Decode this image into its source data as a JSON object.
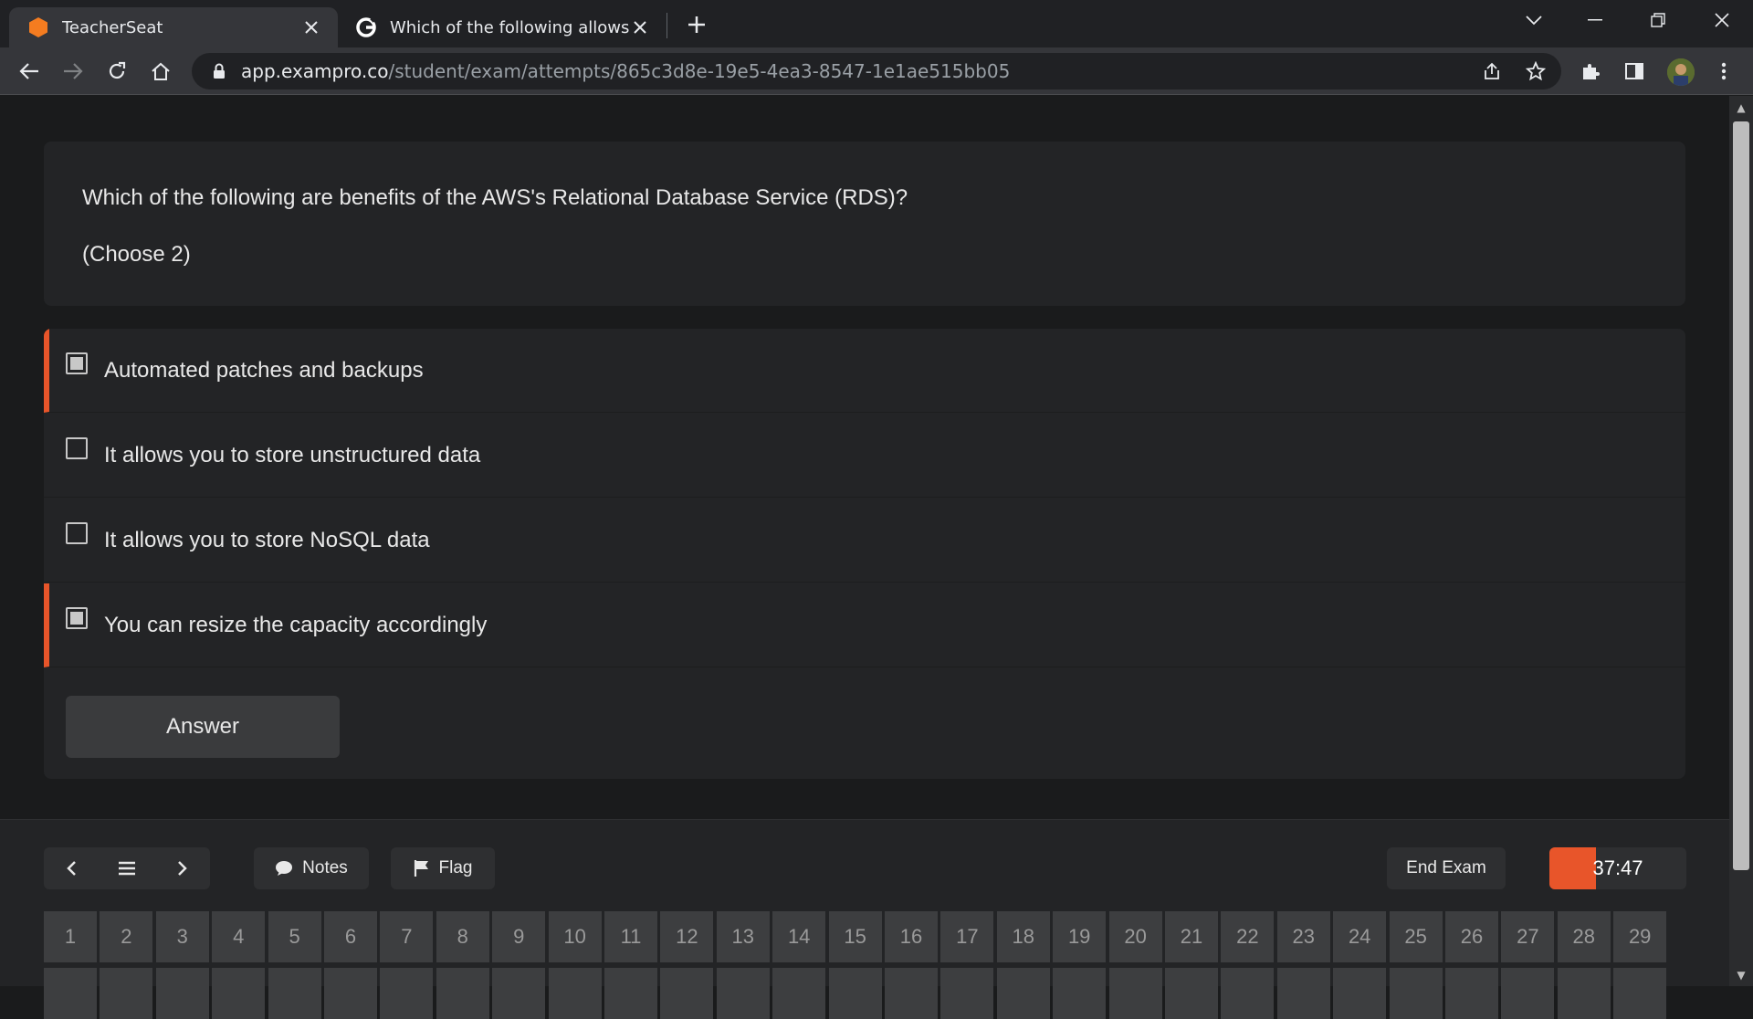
{
  "browser": {
    "tabs": [
      {
        "title": "TeacherSeat",
        "icon": "hexagon-icon",
        "active": true
      },
      {
        "title": "Which of the following allows yo",
        "icon": "google-icon",
        "active": false
      }
    ],
    "url_host": "app.exampro.co",
    "url_path": "/student/exam/attempts/865c3d8e-19e5-4ea3-8547-1e1ae515bb05"
  },
  "question": {
    "text": "Which of the following are benefits of the AWS's Relational Database Service (RDS)?",
    "instruction": "(Choose 2)"
  },
  "options": [
    {
      "label": "Automated patches and backups",
      "checked": true
    },
    {
      "label": "It allows you to store unstructured data",
      "checked": false
    },
    {
      "label": "It allows you to store NoSQL data",
      "checked": false
    },
    {
      "label": "You can resize the capacity accordingly",
      "checked": true
    }
  ],
  "answer_label": "Answer",
  "footer": {
    "notes_label": "Notes",
    "flag_label": "Flag",
    "end_exam_label": "End Exam",
    "timer": "37:47",
    "timer_progress": 0.34,
    "question_numbers": [
      "1",
      "2",
      "3",
      "4",
      "5",
      "6",
      "7",
      "8",
      "9",
      "10",
      "11",
      "12",
      "13",
      "14",
      "15",
      "16",
      "17",
      "18",
      "19",
      "20",
      "21",
      "22",
      "23",
      "24",
      "25",
      "26",
      "27",
      "28",
      "29"
    ]
  },
  "colors": {
    "accent": "#e8552a",
    "card_bg": "#232426",
    "page_bg": "#1a1b1c"
  }
}
